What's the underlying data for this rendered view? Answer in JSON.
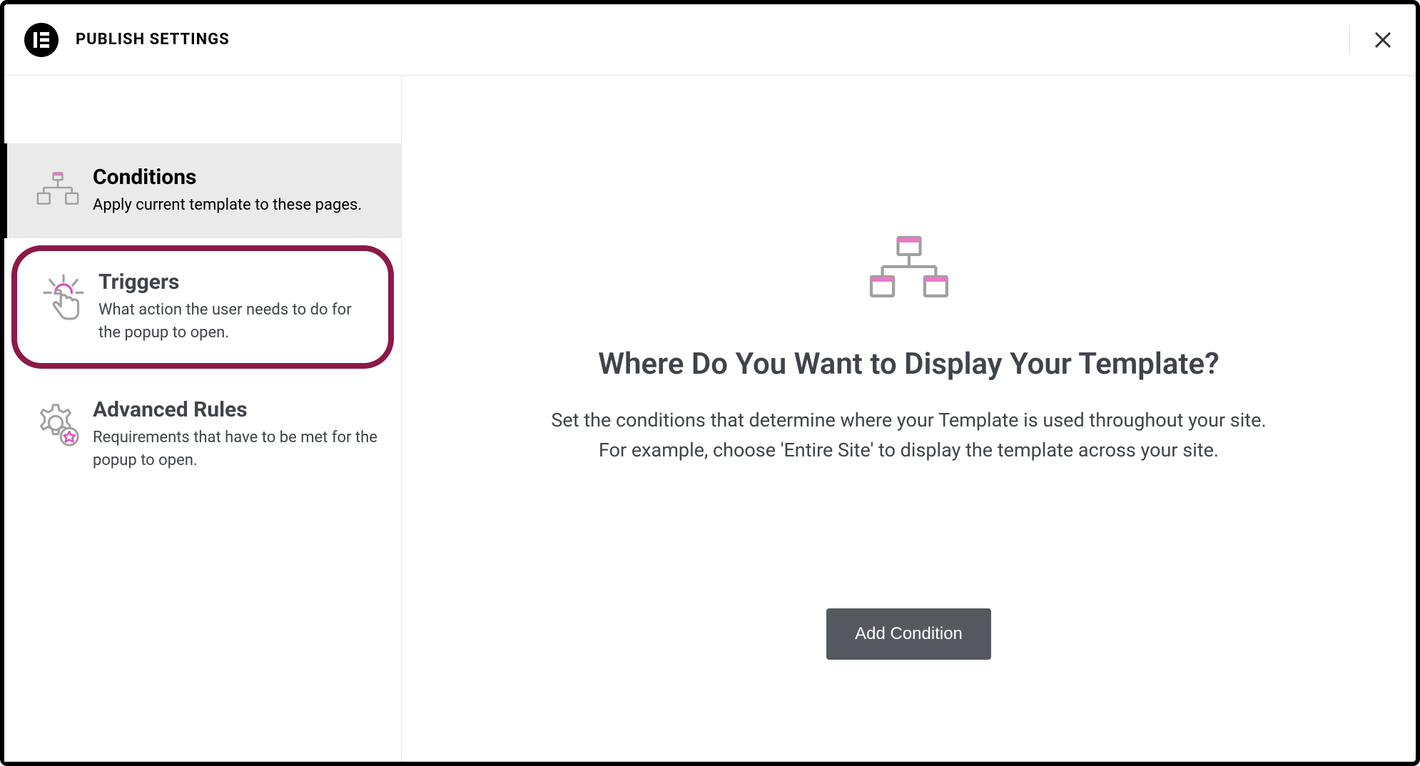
{
  "header": {
    "title": "PUBLISH SETTINGS",
    "logo_letter": "E"
  },
  "sidebar": {
    "items": [
      {
        "title": "Conditions",
        "description": "Apply current template to these pages."
      },
      {
        "title": "Triggers",
        "description": "What action the user needs to do for the popup to open."
      },
      {
        "title": "Advanced Rules",
        "description": "Requirements that have to be met for the popup to open."
      }
    ]
  },
  "main": {
    "title": "Where Do You Want to Display Your Template?",
    "description_line1": "Set the conditions that determine where your Template is used throughout your site.",
    "description_line2": "For example, choose 'Entire Site' to display the template across your site.",
    "add_button": "Add Condition"
  }
}
